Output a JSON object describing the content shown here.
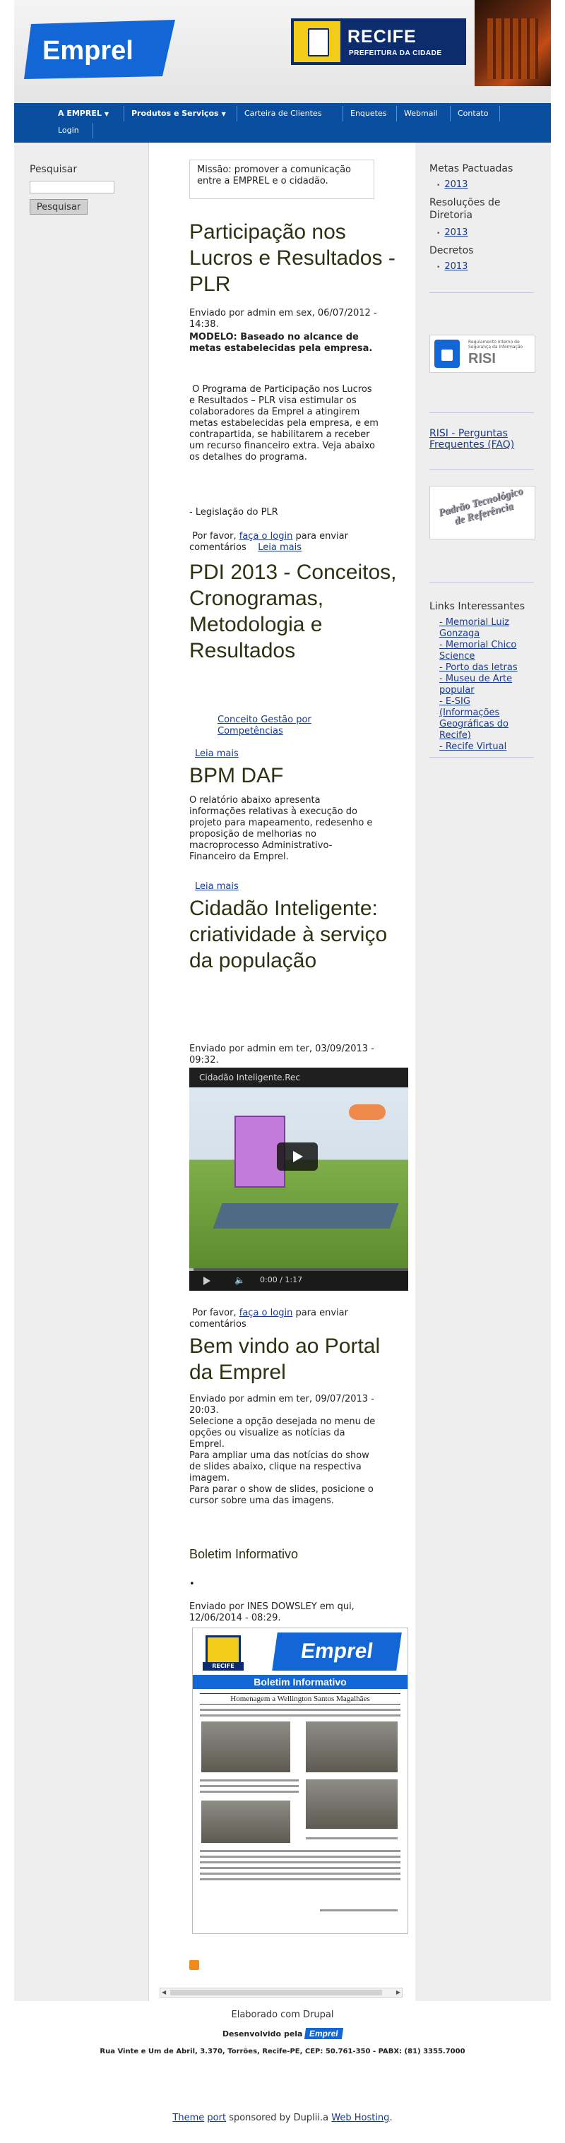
{
  "header": {
    "logo_text": "Emprel",
    "recife_title": "RECIFE",
    "recife_subtitle": "PREFEITURA DA CIDADE"
  },
  "nav": {
    "items": [
      {
        "label": "A EMPREL",
        "has_caret": true
      },
      {
        "label": "Produtos e Serviços",
        "has_caret": true
      },
      {
        "label": "Carteira de Clientes"
      },
      {
        "label": "Enquetes"
      },
      {
        "label": "Webmail"
      },
      {
        "label": "Contato"
      },
      {
        "label": "Login"
      }
    ]
  },
  "search": {
    "label": "Pesquisar",
    "placeholder": "",
    "button": "Pesquisar"
  },
  "mission": "Missão: promover a comunicação entre a EMPREL e o cidadão.",
  "posts": {
    "plr": {
      "title": "Participação nos Lucros e Resultados - PLR",
      "meta": "Enviado por admin em sex, 06/07/2012 - 14:38.",
      "model": "MODELO: Baseado no alcance de metas estabelecidas pela empresa.",
      "body": "O Programa de Participação nos Lucros e Resultados – PLR  visa estimular os colaboradores da Emprel a atingirem metas estabelecidas pela empresa, e em contrapartida, se habilitarem a receber um recurso financeiro extra. Veja abaixo os detalhes do programa.",
      "legislation": "- Legislação do PLR",
      "login_prefix": "Por favor,",
      "login_link": "faça o login",
      "login_suffix": "para enviar comentários",
      "read_more": "Leia mais"
    },
    "pdi": {
      "title": "PDI 2013 - Conceitos, Cronogramas, Metodologia e Resultados",
      "link": "Conceito Gestão por Competências",
      "read_more": "Leia mais"
    },
    "bpm": {
      "title": "BPM DAF",
      "body": "O relatório abaixo apresenta informações relativas à execução do projeto para mapeamento, redesenho e proposição de melhorias no macroprocesso Administrativo-Financeiro da Emprel.",
      "read_more": "Leia mais"
    },
    "cidadao": {
      "title": "Cidadão Inteligente: criatividade à serviço da população",
      "meta": "Enviado por admin em ter, 03/09/2013 - 09:32.",
      "video_title": "Cidadão Inteligente.Rec",
      "video_time": "0:00 / 1:17",
      "video_progress": 0.02,
      "login_prefix": "Por favor,",
      "login_link": "faça o login",
      "login_suffix": "para enviar comentários"
    },
    "bemvindo": {
      "title": "Bem vindo ao Portal da Emprel",
      "meta": "Enviado por admin em ter, 09/07/2013 - 20:03.",
      "body1": "Selecione a opção desejada no menu de opções ou visualize as notícias da Emprel.",
      "body2": "Para ampliar uma das notícias do show de slides abaixo, clique na respectiva imagem.",
      "body3": "Para parar o show de slides, posicione o cursor sobre uma das imagens."
    },
    "boletim": {
      "title": "Boletim Informativo",
      "bullet": "•",
      "meta": "Enviado por INES DOWSLEY em qui, 12/06/2014 - 08:29.",
      "img_brand": "Emprel",
      "img_recife": "RECIFE",
      "img_band": "Boletim Informativo",
      "img_headline": "Homenagem a Wellington Santos Magalhães"
    }
  },
  "sidebar_right": {
    "metas": {
      "title": "Metas Pactuadas",
      "items": [
        "2013"
      ]
    },
    "resolucoes": {
      "title": "Resoluções de Diretoria",
      "items": [
        "2013"
      ]
    },
    "decretos": {
      "title": "Decretos",
      "items": [
        "2013"
      ]
    },
    "risi_badge": {
      "small": "Regulamento Interno de Segurança da Informação",
      "big": "RISI"
    },
    "risi_link": "RISI - Perguntas Frequentes (FAQ)",
    "padrao_badge": "Padrão Tecnológico de Referência",
    "links": {
      "title": "Links Interessantes",
      "items": [
        "- Memorial Luiz Gonzaga",
        "- Memorial Chico Science",
        "- Porto das letras",
        "- Museu de Arte popular",
        "- E-SIG (Informações Geográficas do Recife)",
        "- Recife Virtual"
      ]
    }
  },
  "footer": {
    "drupal": "Elaborado com Drupal",
    "dev_by": "Desenvolvido pela",
    "dev_brand": "Emprel",
    "address": "Rua Vinte e Um de Abril, 3.370, Torrões, Recife-PE, CEP: 50.761-350 - PABX: (81) 3355.7000",
    "theme_link": "Theme",
    "port_link": "port",
    "sponsored": "sponsored by Duplii.a",
    "web_hosting": "Web Hosting",
    "period": "."
  },
  "colors": {
    "nav_bg": "#0a4ea0",
    "title_green": "#2c3212",
    "link_blue": "#1a3a8a",
    "brand_blue": "#1366d6",
    "sidebar_bg": "#eeeeee"
  }
}
